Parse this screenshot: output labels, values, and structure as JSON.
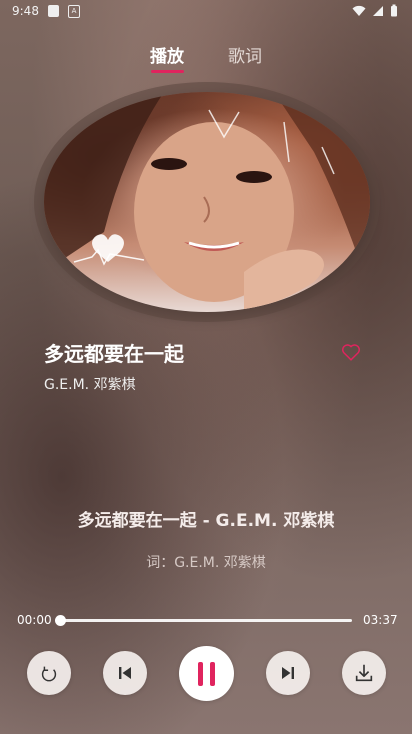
{
  "status_bar": {
    "time": "9:48"
  },
  "tabs": [
    {
      "label": "播放",
      "active": true
    },
    {
      "label": "歌词",
      "active": false
    }
  ],
  "song": {
    "title": "多远都要在一起",
    "artist": "G.E.M. 邓紫棋",
    "liked": false
  },
  "lyrics": {
    "title_line": "多远都要在一起 - G.E.M. 邓紫棋",
    "current_line": "词：G.E.M. 邓紫棋"
  },
  "playback": {
    "current_time": "00:00",
    "total_time": "03:37",
    "progress": 0.0,
    "state": "playing"
  },
  "controls": {
    "loop_icon": "repeat-icon",
    "prev_icon": "skip-previous-icon",
    "play_icon": "pause-icon",
    "next_icon": "skip-next-icon",
    "download_icon": "download-icon"
  },
  "colors": {
    "accent": "#e0245e",
    "heart": "#e0245e"
  }
}
